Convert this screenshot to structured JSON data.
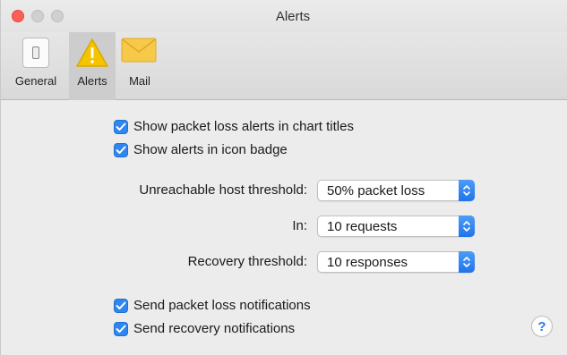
{
  "window": {
    "title": "Alerts"
  },
  "toolbar": {
    "tabs": [
      {
        "label": "General",
        "icon": "switch-icon"
      },
      {
        "label": "Alerts",
        "icon": "warning-icon",
        "selected": true
      },
      {
        "label": "Mail",
        "icon": "envelope-icon"
      }
    ]
  },
  "checks": {
    "packet_loss_titles": {
      "label": "Show packet loss alerts in chart titles",
      "checked": true
    },
    "icon_badge": {
      "label": "Show alerts in icon badge",
      "checked": true
    },
    "send_packet_loss": {
      "label": "Send packet loss notifications",
      "checked": true
    },
    "send_recovery": {
      "label": "Send recovery notifications",
      "checked": true
    }
  },
  "unreachable": {
    "label": "Unreachable host threshold:",
    "value": "50% packet loss"
  },
  "in": {
    "label": "In:",
    "value": "10 requests"
  },
  "recovery": {
    "label": "Recovery threshold:",
    "value": "10 responses"
  },
  "help": {
    "label": "?"
  },
  "colors": {
    "accent": "#2f86f0",
    "close": "#fc5f57",
    "warning": "#f5c400"
  }
}
